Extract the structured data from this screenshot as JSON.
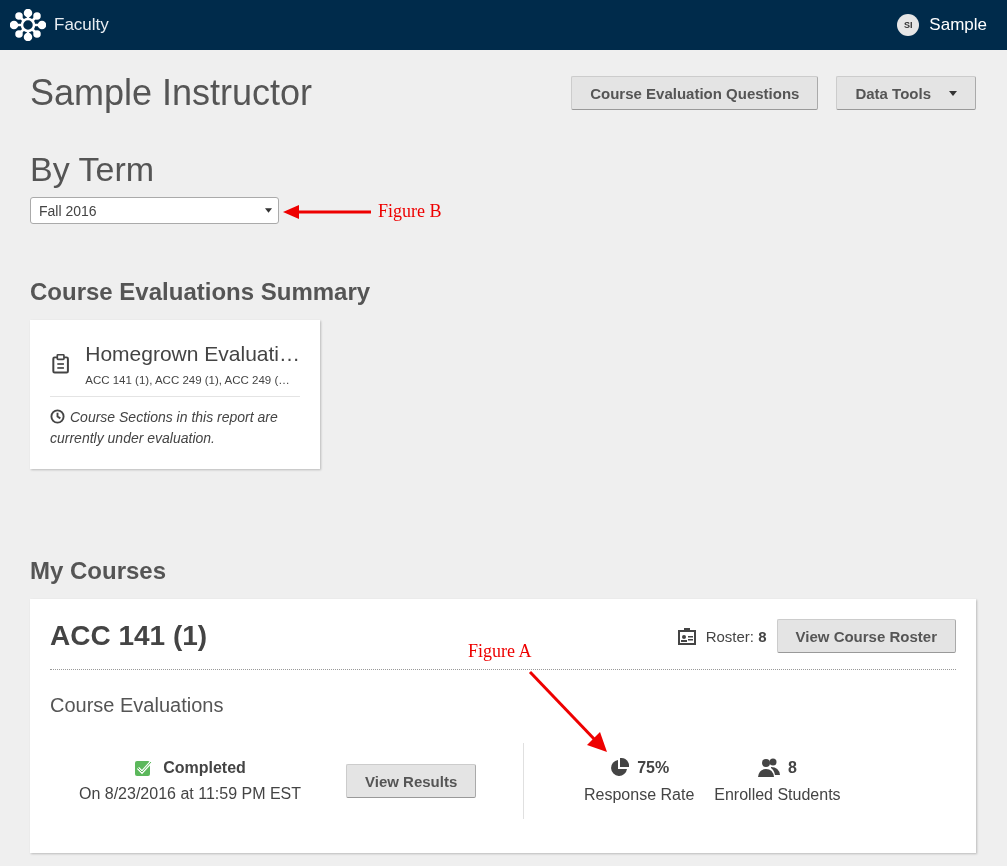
{
  "top_bar": {
    "app_name": "Faculty",
    "user_initials": "SI",
    "user_name": "Sample"
  },
  "header": {
    "title": "Sample Instructor",
    "buttons": [
      {
        "label": "Course Evaluation Questions",
        "kind": "plain"
      },
      {
        "label": "Data Tools",
        "kind": "dropdown"
      }
    ]
  },
  "term": {
    "heading": "By Term",
    "select_value": "Fall 2016"
  },
  "summary": {
    "heading": "Course Evaluations Summary",
    "cards": [
      {
        "title": "Homegrown Evaluati…",
        "courses": "ACC 141 (1), ACC 249 (1), ACC 249 (…",
        "note": "Course Sections in this report are currently under evaluation."
      }
    ]
  },
  "my_courses": {
    "heading": "My Courses",
    "courses": [
      {
        "code": "ACC 141 (1)",
        "roster_label": "Roster:",
        "roster_count": "8",
        "roster_button": "View Course Roster",
        "section_title": "Course Evaluations",
        "status": "Completed",
        "completed": true,
        "date": "On 8/23/2016 at 11:59 PM EST",
        "results_button": "View Results",
        "stats": [
          {
            "kind": "response",
            "value": "75%",
            "label": "Response Rate"
          },
          {
            "kind": "enrolled",
            "value": "8",
            "label": "Enrolled Students"
          }
        ]
      }
    ]
  },
  "annotations": [
    {
      "kind": "horizontal",
      "label": "Figure B"
    },
    {
      "kind": "diagonal",
      "label": "Figure A"
    }
  ]
}
